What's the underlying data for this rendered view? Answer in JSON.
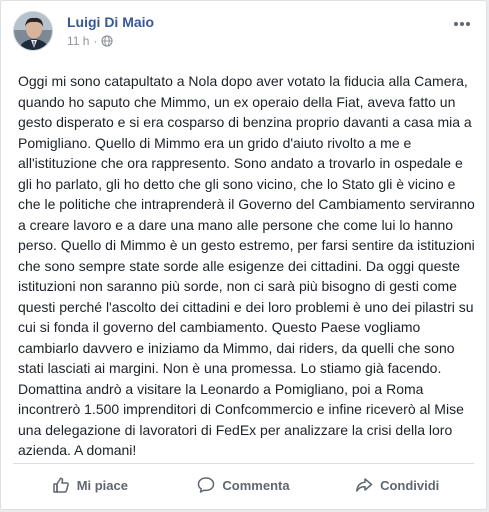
{
  "post": {
    "author": "Luigi Di Maio",
    "timestamp": "11 h",
    "separator": "·",
    "audience_icon": "globe-icon",
    "more_icon": "ellipsis-icon",
    "body": "Oggi mi sono catapultato a Nola dopo aver votato la fiducia alla Camera, quando ho saputo che Mimmo, un ex operaio della Fiat, aveva fatto un gesto disperato e si era cosparso di benzina proprio davanti a casa mia a Pomigliano. Quello di Mimmo era un grido d'aiuto rivolto a me e all'istituzione che ora rappresento. Sono andato a trovarlo in ospedale e gli ho parlato, gli ho detto che gli sono vicino, che lo Stato gli è vicino e che le politiche che intraprenderà il Governo del Cambiamento serviranno a creare lavoro e a dare una mano alle persone che come lui lo hanno perso. Quello di Mimmo è un gesto estremo, per farsi sentire da istituzioni che sono sempre state sorde alle esigenze dei cittadini. Da oggi queste istituzioni non saranno più sorde, non ci sarà più bisogno di gesti come questi perché l'ascolto dei cittadini e dei loro problemi è uno dei pilastri su cui si fonda il governo del cambiamento. Questo Paese vogliamo cambiarlo davvero e iniziamo da Mimmo, dai riders, da quelli che sono stati lasciati ai margini. Non è una promessa. Lo stiamo già facendo. Domattina andrò a visitare la Leonardo a Pomigliano, poi a Roma incontrerò 1.500 imprenditori di Confcommercio e infine riceverò al Mise una delegazione di lavoratori di FedEx per analizzare la crisi della loro azienda. A domani!"
  },
  "actions": {
    "like": {
      "label": "Mi piace",
      "icon": "thumbs-up-icon"
    },
    "comment": {
      "label": "Commenta",
      "icon": "comment-icon"
    },
    "share": {
      "label": "Condividi",
      "icon": "share-icon"
    }
  },
  "colors": {
    "author_link": "#365899",
    "meta_text": "#90949c",
    "body_text": "#1d2129",
    "action_text": "#606770",
    "card_border": "#dddfe2",
    "page_background": "#e9ebee"
  }
}
